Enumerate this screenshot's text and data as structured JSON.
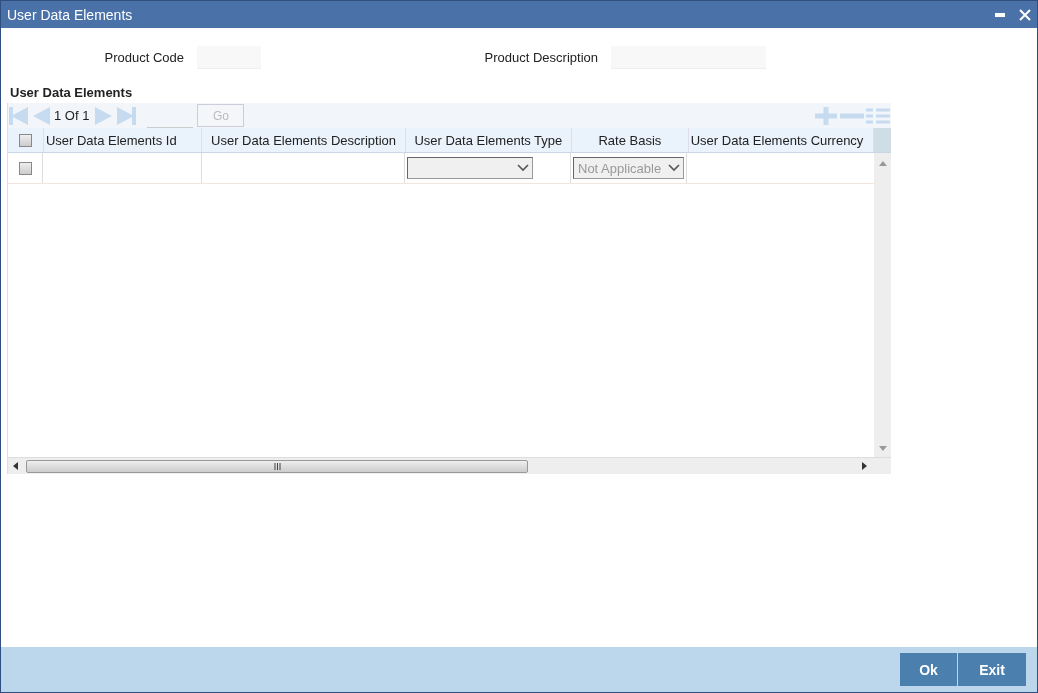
{
  "window": {
    "title": "User Data Elements"
  },
  "fields": [
    {
      "label": "Product Code"
    },
    {
      "label": "Product Description"
    }
  ],
  "section": {
    "title": "User Data Elements"
  },
  "pager": {
    "text": "1 Of 1",
    "go": "Go"
  },
  "table": {
    "select_all": {
      "checked": false
    },
    "columns": [
      "User Data Elements Id",
      "User Data Elements Description",
      "User Data Elements Type",
      "Rate Basis",
      "User Data Elements Currency"
    ],
    "rows": [
      {
        "checked": false,
        "rate_basis": "Not Applicable"
      }
    ]
  },
  "buttons": [
    "Ok",
    "Exit"
  ]
}
